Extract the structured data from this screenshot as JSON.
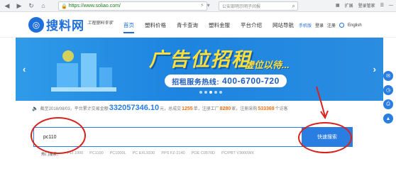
{
  "browser": {
    "url": "https://www.soliao.com/",
    "search_placeholder": "公安部明示明子间报",
    "right_items": [
      "扩展",
      "登录管家"
    ]
  },
  "header": {
    "logo_text": "搜料网",
    "slogan": "工程塑料专家",
    "nav": [
      "首页",
      "塑料价格",
      "青卡查询",
      "塑料金服",
      "平台介绍",
      "网站导航"
    ],
    "right": {
      "mobile": "手机版",
      "login": "登录",
      "register": "注册",
      "english": "English"
    }
  },
  "banner": {
    "title": "广告位招租",
    "subtitle": "虚位以待...",
    "hotline_label": "招租服务热线:",
    "hotline_number": "400-6700-720"
  },
  "stats": {
    "prefix": "截至2018/08/03，平台累计交易金额",
    "amount": "332057346.10",
    "unit1": "元，总成交",
    "orders": "1255",
    "unit2": "单，注册工厂",
    "factories": "8280",
    "unit3": "家，注册采购",
    "buyers": "533369",
    "unit4": "个访客"
  },
  "search": {
    "value": "pc110",
    "button_label": "快速搜索",
    "hot_label": "热门搜索：",
    "hot_terms": [
      "PEI 1000",
      "PC1100",
      "PC1000L",
      "PC EXL9330",
      "PPS FZ-2140",
      "POE C0570D",
      "PC/PBT V3000WX"
    ]
  },
  "colors": {
    "brand": "#1e6fd9",
    "banner": "#1d84e0",
    "highlight": "#ffe03a",
    "annotation": "#d8221d"
  }
}
